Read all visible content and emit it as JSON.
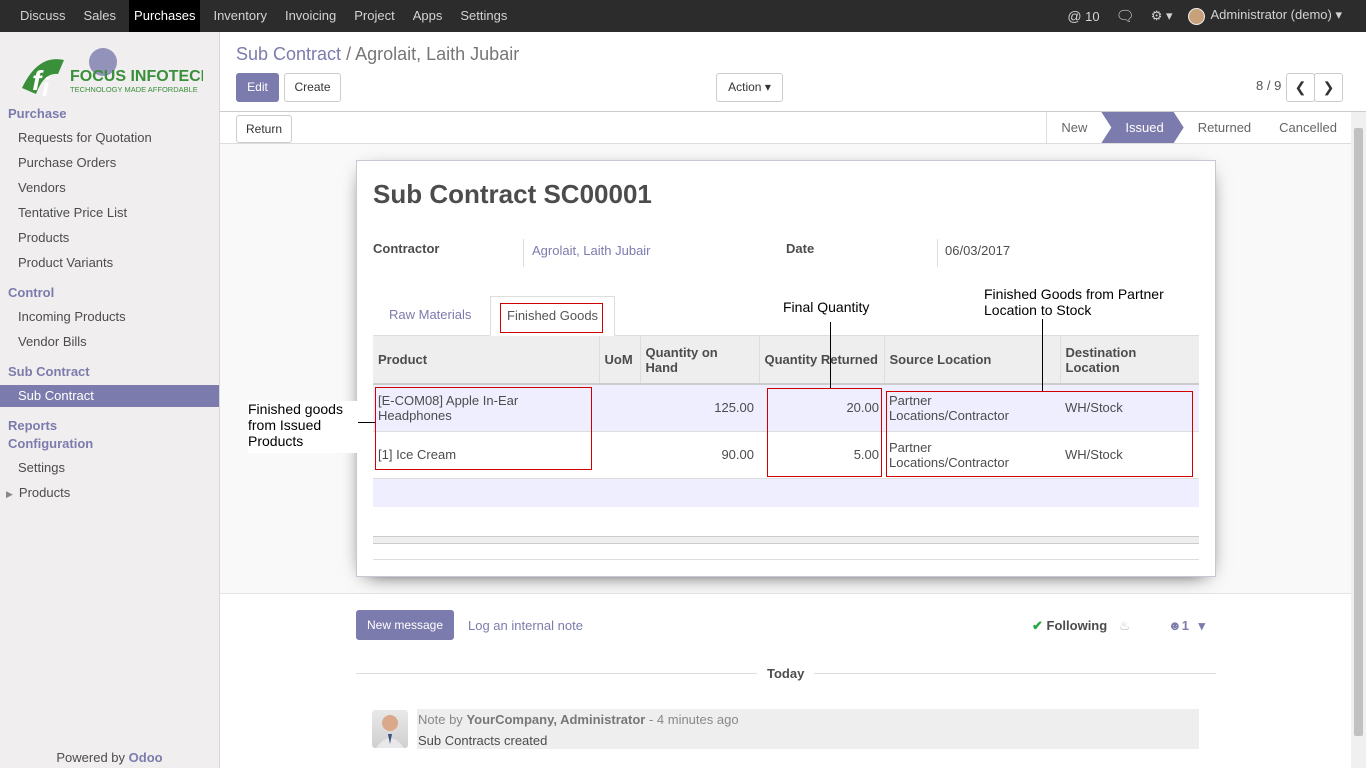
{
  "topbar": {
    "menu": [
      "Discuss",
      "Sales",
      "Purchases",
      "Inventory",
      "Invoicing",
      "Project",
      "Apps",
      "Settings"
    ],
    "active_menu": "Purchases",
    "mention_count": "10",
    "user": "Administrator (demo)"
  },
  "logo": {
    "name": "FOCUS INFOTECH",
    "tagline": "TECHNOLOGY MADE AFFORDABLE"
  },
  "sidebar": {
    "purchase_header": "Purchase",
    "purchase_items": [
      "Requests for Quotation",
      "Purchase Orders",
      "Vendors",
      "Tentative Price List",
      "Products",
      "Product Variants"
    ],
    "control_header": "Control",
    "control_items": [
      "Incoming Products",
      "Vendor Bills"
    ],
    "subcontract_header": "Sub Contract",
    "subcontract_item": "Sub Contract",
    "reports_header": "Reports",
    "config_header": "Configuration",
    "config_items": [
      "Settings",
      "Products"
    ],
    "powered_by": "Powered by",
    "powered_brand": "Odoo"
  },
  "breadcrumb": {
    "parent": "Sub Contract",
    "separator": "/",
    "current": "Agrolait, Laith Jubair"
  },
  "buttons": {
    "edit": "Edit",
    "create": "Create",
    "action": "Action",
    "return": "Return"
  },
  "pager": {
    "value": "8 / 9"
  },
  "statusbar": {
    "stages": [
      "New",
      "Issued",
      "Returned",
      "Cancelled"
    ],
    "current": "Issued"
  },
  "form": {
    "title": "Sub Contract SC00001",
    "contractor_label": "Contractor",
    "contractor_value": "Agrolait, Laith Jubair",
    "date_label": "Date",
    "date_value": "06/03/2017",
    "tabs": [
      "Raw Materials",
      "Finished Goods"
    ],
    "active_tab": "Finished Goods",
    "columns": [
      "Product",
      "UoM",
      "Quantity on Hand",
      "Quantity Returned",
      "Source Location",
      "Destination Location"
    ],
    "rows": [
      {
        "product": "[E-COM08] Apple In-Ear Headphones",
        "uom": "",
        "qty_on_hand": "125.00",
        "qty_returned": "20.00",
        "source": "Partner Locations/Contractor",
        "destination": "WH/Stock"
      },
      {
        "product": "[1] Ice Cream",
        "uom": "",
        "qty_on_hand": "90.00",
        "qty_returned": "5.00",
        "source": "Partner Locations/Contractor",
        "destination": "WH/Stock"
      }
    ]
  },
  "annotations": {
    "final_quantity": "Final Quantity",
    "finished_goods_partner": "Finished Goods from Partner Location to Stock",
    "finished_goods_issued": "Finished goods from Issued Products"
  },
  "chatter": {
    "new_message": "New message",
    "log_note": "Log an internal note",
    "following": "Following",
    "followers": "1",
    "today": "Today",
    "note_prefix": "Note by",
    "author": "YourCompany, Administrator",
    "time": "- 4 minutes ago",
    "body": "Sub Contracts created"
  },
  "colors": {
    "brand": "#7c7bad",
    "topbar": "#2c2c2c",
    "annotation_box": "#d00000"
  }
}
